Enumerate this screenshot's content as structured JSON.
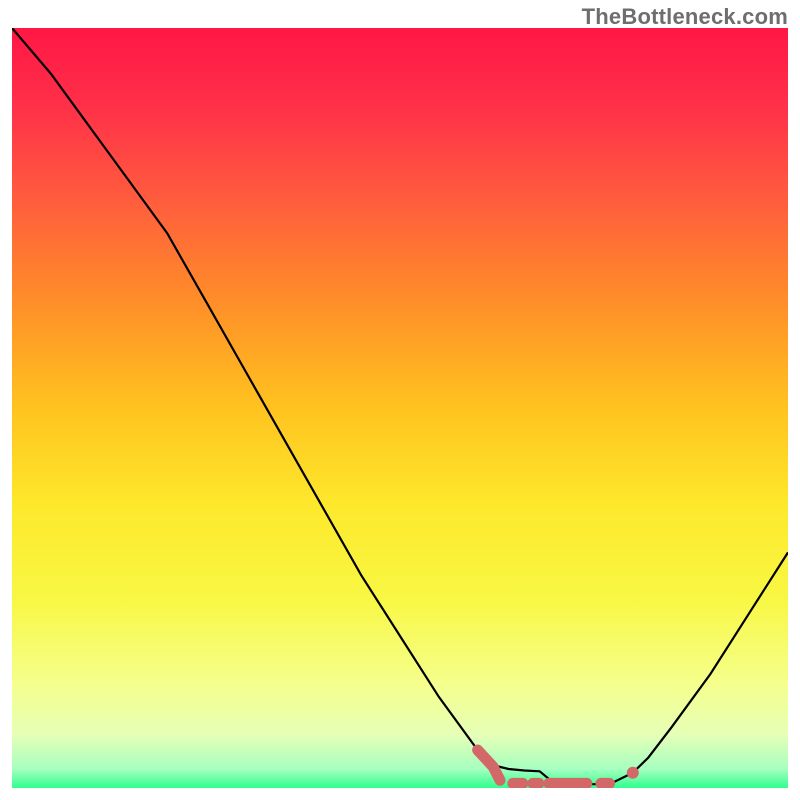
{
  "watermark": "TheBottleneck.com",
  "chart_data": {
    "type": "line",
    "title": "",
    "xlabel": "",
    "ylabel": "",
    "xlim": [
      0,
      100
    ],
    "ylim": [
      0,
      100
    ],
    "grid": false,
    "series": [
      {
        "name": "curve",
        "x": [
          0,
          5,
          10,
          15,
          20,
          25,
          30,
          35,
          40,
          45,
          50,
          55,
          60,
          62,
          64,
          66,
          68,
          70,
          73,
          77,
          80,
          82,
          85,
          90,
          95,
          100
        ],
        "y": [
          100,
          94,
          87,
          80,
          73,
          64,
          55,
          46,
          37,
          28,
          20,
          12,
          5,
          3,
          2.5,
          2.3,
          2.2,
          0.5,
          0.5,
          0.5,
          2,
          4,
          8,
          15,
          23,
          31
        ]
      }
    ],
    "highlight_segment": {
      "x": [
        60,
        62,
        63,
        64,
        66,
        68,
        70,
        73,
        77
      ],
      "y": [
        5,
        2.8,
        0.8,
        0.6,
        0.6,
        0.6,
        0.6,
        0.6,
        0.6
      ]
    },
    "highlight_dot": {
      "x": 80,
      "y": 2
    },
    "gradient_stops": [
      {
        "offset": 0.0,
        "color": "#ff1744"
      },
      {
        "offset": 0.1,
        "color": "#ff2f49"
      },
      {
        "offset": 0.22,
        "color": "#ff5a3e"
      },
      {
        "offset": 0.35,
        "color": "#ff8a2a"
      },
      {
        "offset": 0.5,
        "color": "#ffc31f"
      },
      {
        "offset": 0.63,
        "color": "#fde92c"
      },
      {
        "offset": 0.75,
        "color": "#f8f743"
      },
      {
        "offset": 0.86,
        "color": "#f5ff8a"
      },
      {
        "offset": 0.93,
        "color": "#e6ffb7"
      },
      {
        "offset": 0.975,
        "color": "#a6ffc0"
      },
      {
        "offset": 1.0,
        "color": "#2fff8e"
      }
    ],
    "colors": {
      "curve": "#000000",
      "highlight": "#d26868"
    }
  }
}
